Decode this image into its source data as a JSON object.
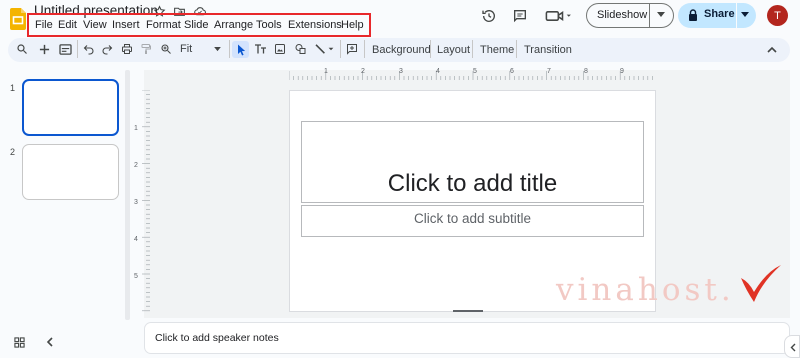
{
  "app": {
    "title": "Untitled presentation"
  },
  "menu": {
    "items": [
      "File",
      "Edit",
      "View",
      "Insert",
      "Format",
      "Slide",
      "Arrange",
      "Tools",
      "Extensions",
      "Help"
    ],
    "highlight_color": "#e8282b"
  },
  "header": {
    "slideshow_label": "Slideshow",
    "share_label": "Share",
    "avatar_letter": "T"
  },
  "toolbar": {
    "zoom_value": "Fit",
    "background_label": "Background",
    "layout_label": "Layout",
    "theme_label": "Theme",
    "transition_label": "Transition"
  },
  "filmstrip": {
    "slides": [
      {
        "number": "1",
        "selected": true
      },
      {
        "number": "2",
        "selected": false
      }
    ]
  },
  "ruler": {
    "horizontal": [
      "1",
      "2",
      "3",
      "4",
      "5",
      "6",
      "7",
      "8",
      "9"
    ],
    "vertical": [
      "1",
      "2",
      "3",
      "4",
      "5"
    ]
  },
  "slide": {
    "title_placeholder": "Click to add title",
    "subtitle_placeholder": "Click to add subtitle"
  },
  "notes": {
    "placeholder": "Click to add speaker notes"
  },
  "watermark": {
    "text": "vinahost."
  },
  "colors": {
    "accent": "#0b57d0",
    "share_bg": "#c2e7ff",
    "avatar_bg": "#b3261e",
    "logo": "#f4b400"
  }
}
